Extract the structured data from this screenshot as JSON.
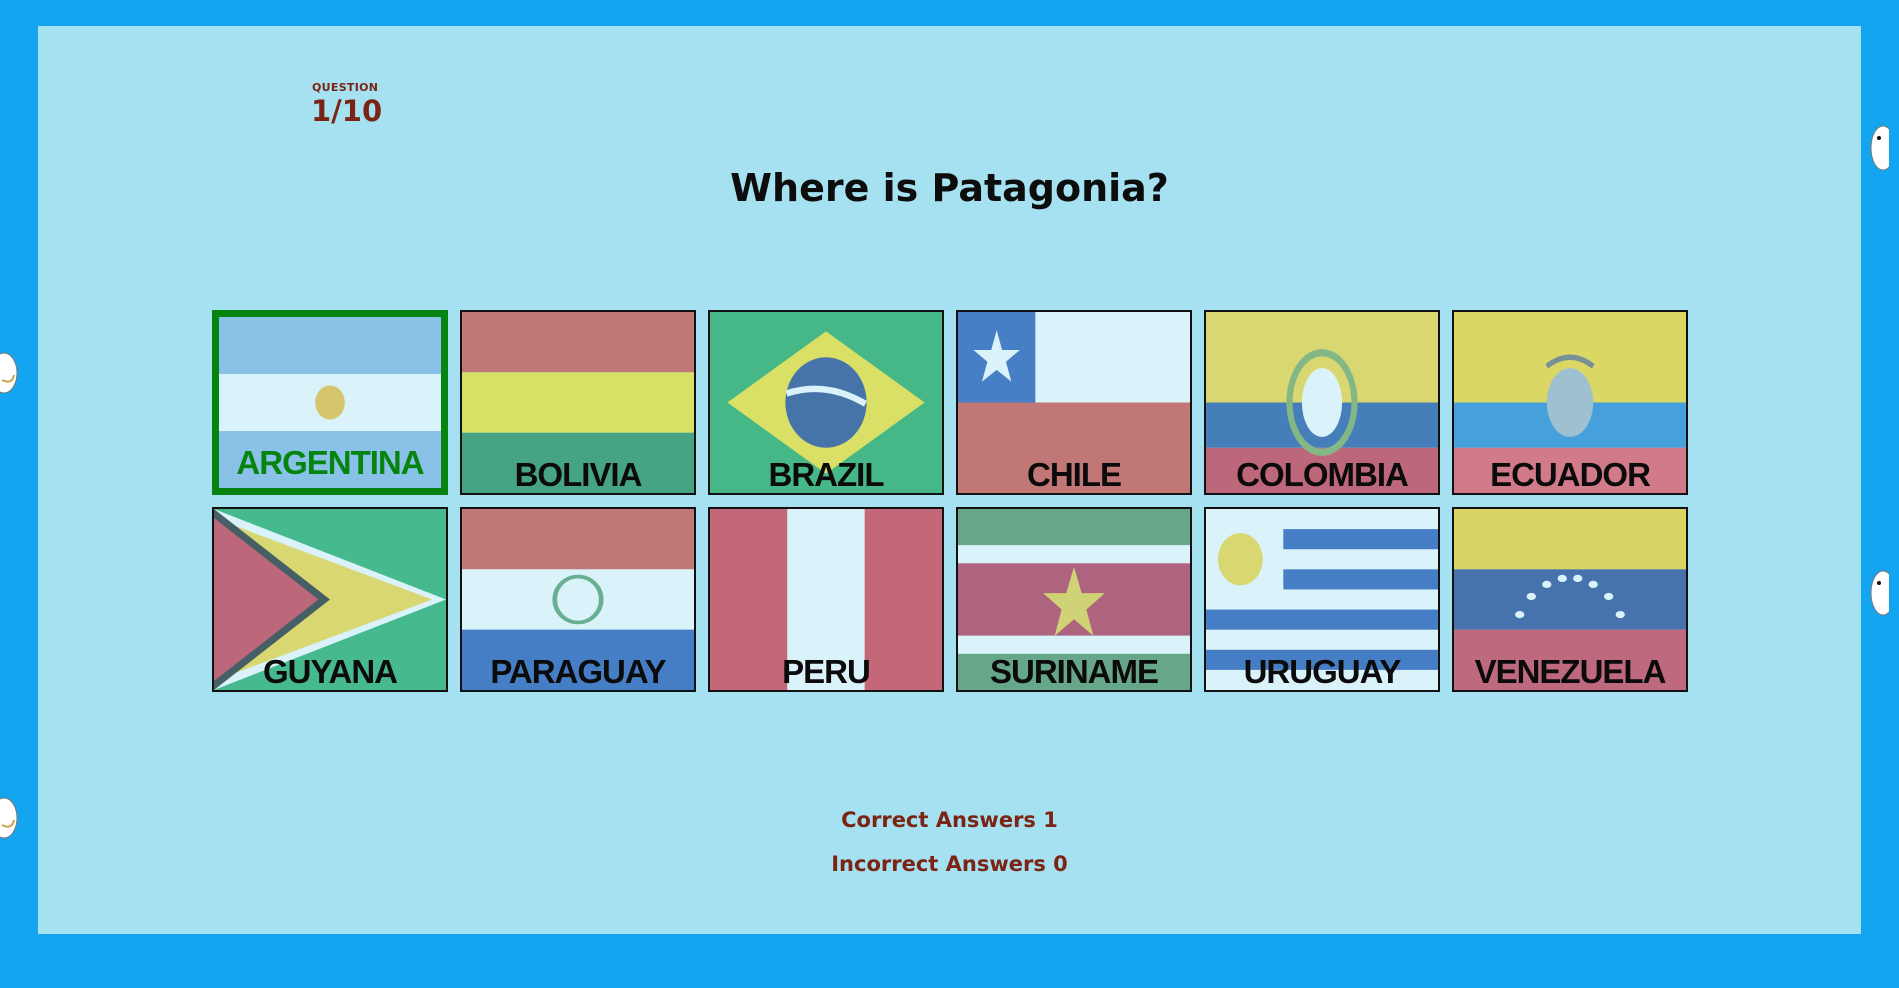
{
  "question_header": {
    "label": "QUESTION",
    "count": "1/10"
  },
  "question": "Where is Patagonia?",
  "options": [
    {
      "name": "ARGENTINA",
      "selected": true
    },
    {
      "name": "BOLIVIA"
    },
    {
      "name": "BRAZIL"
    },
    {
      "name": "CHILE"
    },
    {
      "name": "COLOMBIA"
    },
    {
      "name": "ECUADOR"
    },
    {
      "name": "GUYANA"
    },
    {
      "name": "PARAGUAY"
    },
    {
      "name": "PERU"
    },
    {
      "name": "SURINAME"
    },
    {
      "name": "URUGUAY"
    },
    {
      "name": "VENEZUELA"
    }
  ],
  "score": {
    "correct": "Correct Answers 1",
    "incorrect": "Incorrect Answers 0"
  },
  "colors": {
    "background": "#14a5f1",
    "panel": "#a6e1f1",
    "correct": "#07840f",
    "text_accent": "#7a2414"
  }
}
